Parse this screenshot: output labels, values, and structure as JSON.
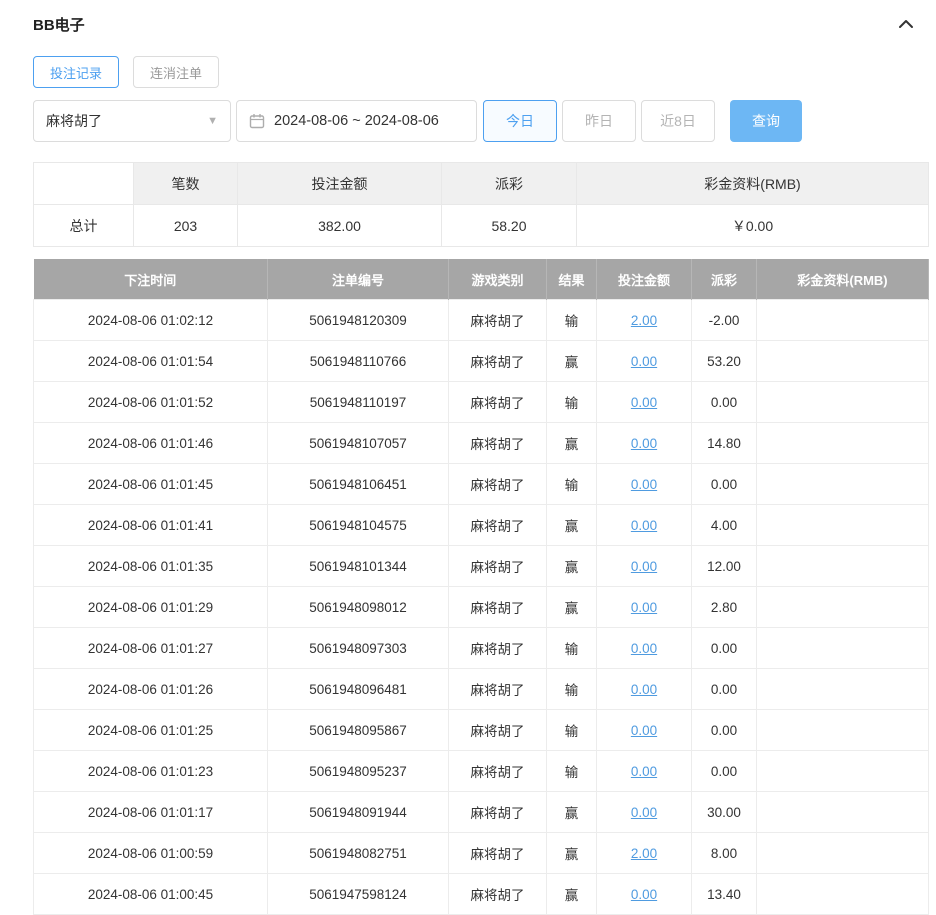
{
  "colors": {
    "accent": "#4da0f0",
    "accent_button": "#6db7f4",
    "link": "#4f9be0",
    "negative": "#e25b5b",
    "table_header_bg": "#a6a6a6",
    "summary_header_bg": "#f0f0f0"
  },
  "header": {
    "title": "BB电子"
  },
  "tabs": [
    {
      "label": "投注记录",
      "active": true
    },
    {
      "label": "连消注单",
      "active": false
    }
  ],
  "filters": {
    "game_select_value": "麻将胡了",
    "date_range": "2024-08-06 ~ 2024-08-06",
    "quick_buttons": [
      {
        "label": "今日",
        "active": true
      },
      {
        "label": "昨日",
        "active": false
      },
      {
        "label": "近8日",
        "active": false
      }
    ],
    "search_label": "查询"
  },
  "summary": {
    "headers": [
      "",
      "笔数",
      "投注金额",
      "派彩",
      "彩金资料(RMB)"
    ],
    "row_label": "总计",
    "count": "203",
    "bet_amount": "382.00",
    "payout": "58.20",
    "bonus": "￥0.00"
  },
  "table": {
    "headers": [
      "下注时间",
      "注单编号",
      "游戏类别",
      "结果",
      "投注金额",
      "派彩",
      "彩金资料(RMB)"
    ],
    "rows": [
      {
        "time": "2024-08-06 01:02:12",
        "order": "5061948120309",
        "game": "麻将胡了",
        "result": "输",
        "bet": "2.00",
        "payout": "-2.00",
        "negative": true,
        "bonus": ""
      },
      {
        "time": "2024-08-06 01:01:54",
        "order": "5061948110766",
        "game": "麻将胡了",
        "result": "赢",
        "bet": "0.00",
        "payout": "53.20",
        "negative": false,
        "bonus": ""
      },
      {
        "time": "2024-08-06 01:01:52",
        "order": "5061948110197",
        "game": "麻将胡了",
        "result": "输",
        "bet": "0.00",
        "payout": "0.00",
        "negative": false,
        "bonus": ""
      },
      {
        "time": "2024-08-06 01:01:46",
        "order": "5061948107057",
        "game": "麻将胡了",
        "result": "赢",
        "bet": "0.00",
        "payout": "14.80",
        "negative": false,
        "bonus": ""
      },
      {
        "time": "2024-08-06 01:01:45",
        "order": "5061948106451",
        "game": "麻将胡了",
        "result": "输",
        "bet": "0.00",
        "payout": "0.00",
        "negative": false,
        "bonus": ""
      },
      {
        "time": "2024-08-06 01:01:41",
        "order": "5061948104575",
        "game": "麻将胡了",
        "result": "赢",
        "bet": "0.00",
        "payout": "4.00",
        "negative": false,
        "bonus": ""
      },
      {
        "time": "2024-08-06 01:01:35",
        "order": "5061948101344",
        "game": "麻将胡了",
        "result": "赢",
        "bet": "0.00",
        "payout": "12.00",
        "negative": false,
        "bonus": ""
      },
      {
        "time": "2024-08-06 01:01:29",
        "order": "5061948098012",
        "game": "麻将胡了",
        "result": "赢",
        "bet": "0.00",
        "payout": "2.80",
        "negative": false,
        "bonus": ""
      },
      {
        "time": "2024-08-06 01:01:27",
        "order": "5061948097303",
        "game": "麻将胡了",
        "result": "输",
        "bet": "0.00",
        "payout": "0.00",
        "negative": false,
        "bonus": ""
      },
      {
        "time": "2024-08-06 01:01:26",
        "order": "5061948096481",
        "game": "麻将胡了",
        "result": "输",
        "bet": "0.00",
        "payout": "0.00",
        "negative": false,
        "bonus": ""
      },
      {
        "time": "2024-08-06 01:01:25",
        "order": "5061948095867",
        "game": "麻将胡了",
        "result": "输",
        "bet": "0.00",
        "payout": "0.00",
        "negative": false,
        "bonus": ""
      },
      {
        "time": "2024-08-06 01:01:23",
        "order": "5061948095237",
        "game": "麻将胡了",
        "result": "输",
        "bet": "0.00",
        "payout": "0.00",
        "negative": false,
        "bonus": ""
      },
      {
        "time": "2024-08-06 01:01:17",
        "order": "5061948091944",
        "game": "麻将胡了",
        "result": "赢",
        "bet": "0.00",
        "payout": "30.00",
        "negative": false,
        "bonus": ""
      },
      {
        "time": "2024-08-06 01:00:59",
        "order": "5061948082751",
        "game": "麻将胡了",
        "result": "赢",
        "bet": "2.00",
        "payout": "8.00",
        "negative": false,
        "bonus": ""
      },
      {
        "time": "2024-08-06 01:00:45",
        "order": "5061947598124",
        "game": "麻将胡了",
        "result": "赢",
        "bet": "0.00",
        "payout": "13.40",
        "negative": false,
        "bonus": ""
      }
    ]
  }
}
